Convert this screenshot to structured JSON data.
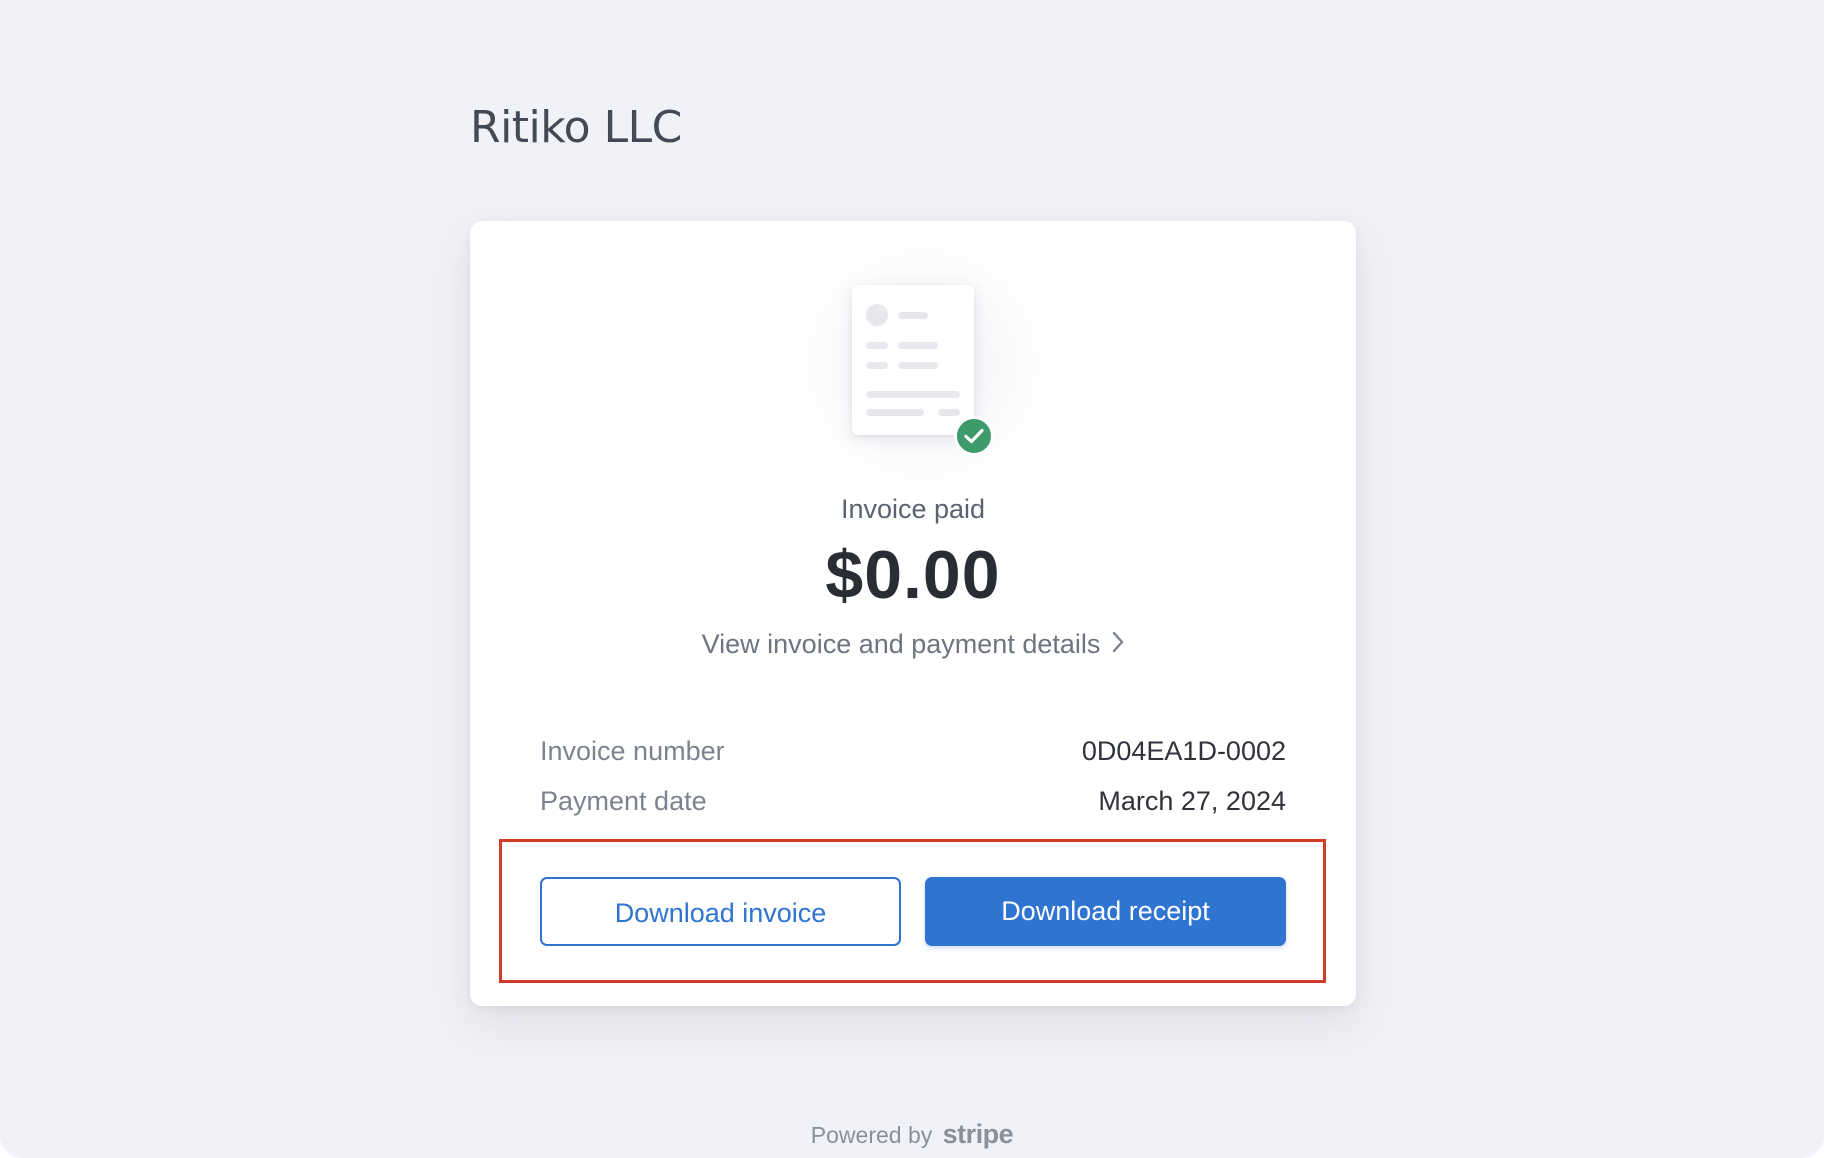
{
  "merchant": {
    "name": "Ritiko LLC"
  },
  "invoice": {
    "status": "Invoice paid",
    "amount": "$0.00",
    "details_link": "View invoice and payment details",
    "rows": [
      {
        "label": "Invoice number",
        "value": "0D04EA1D-0002"
      },
      {
        "label": "Payment date",
        "value": "March 27, 2024"
      }
    ]
  },
  "actions": {
    "download_invoice": "Download invoice",
    "download_receipt": "Download receipt"
  },
  "footer": {
    "powered_by": "Powered by",
    "brand": "stripe"
  },
  "icons": {
    "document": "invoice-document-icon",
    "check": "check-circle-icon",
    "chevron": "chevron-right-icon"
  },
  "colors": {
    "accent": "#2f74d0",
    "success": "#3d9a6a",
    "highlight": "#d13c2a",
    "background": "#f1f2f7"
  }
}
